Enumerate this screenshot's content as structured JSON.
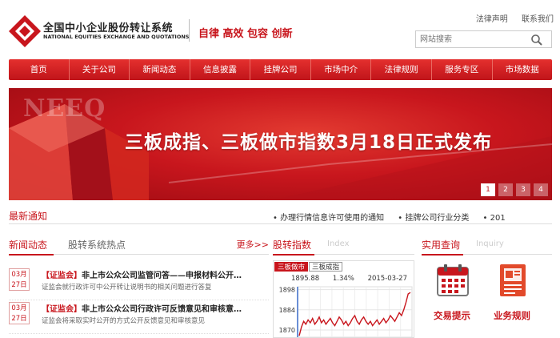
{
  "header": {
    "logo_cn": "全国中小企业股份转让系统",
    "logo_en": "NATIONAL EQUITIES EXCHANGE AND QUOTATIONS",
    "slogan": "自律 高效 包容 创新",
    "top_links": [
      "法律声明",
      "联系我们"
    ],
    "search_placeholder": "网站搜索"
  },
  "nav": [
    "首页",
    "关于公司",
    "新闻动态",
    "信息披露",
    "挂牌公司",
    "市场中介",
    "法律规则",
    "服务专区",
    "市场数据"
  ],
  "banner": {
    "watermark": "NEEQ",
    "title": "三板成指、三板做市指数3月18日正式发布",
    "pages": [
      "1",
      "2",
      "3",
      "4"
    ],
    "active_page": "1"
  },
  "notice": {
    "title": "最新通知",
    "items": [
      "• 办理行情信息许可使用的通知",
      "• 挂牌公司行业分类",
      "• 201"
    ]
  },
  "news": {
    "tab1": "新闻动态",
    "tab2": "股转系统热点",
    "more": "更多>>",
    "items": [
      {
        "month": "03月",
        "day": "27日",
        "tag": "【证监会】",
        "title": "非上市公众公司监管问答——申报材料公开…",
        "sub": "证监会就行政许可中公开转让说明书的相关问题进行答复"
      },
      {
        "month": "03月",
        "day": "27日",
        "tag": "【证监会】",
        "title": "非上市公众公司行政许可反馈意见和审核意…",
        "sub": "证监会将采取实时公开的方式公开反馈意见和审核意见"
      }
    ]
  },
  "index": {
    "title": "股转指数",
    "title_en": "Index",
    "tabs": [
      "三板做市",
      "三板成指"
    ],
    "active_tab": "三板做市",
    "value": "1895.88",
    "change": "1.34%",
    "date": "2015-03-27",
    "y_ticks": [
      "1898",
      "1884",
      "1870"
    ]
  },
  "chart_data": {
    "type": "line",
    "title": "",
    "ylim": [
      1865,
      1900
    ],
    "y_ticks": [
      1898,
      1884,
      1870
    ],
    "series": [
      {
        "values": [
          1866,
          1872,
          1876,
          1874,
          1877,
          1875,
          1878,
          1874,
          1876,
          1879,
          1875,
          1877,
          1874,
          1876,
          1878,
          1875,
          1873,
          1876,
          1879,
          1877,
          1874,
          1876,
          1873,
          1875,
          1878,
          1880,
          1876,
          1874,
          1877,
          1879,
          1876,
          1874,
          1876,
          1873,
          1875,
          1877,
          1874,
          1876,
          1878,
          1875,
          1877,
          1880,
          1878,
          1876,
          1879,
          1882,
          1880,
          1884,
          1889,
          1895,
          1896
        ]
      }
    ]
  },
  "quick": {
    "title": "实用查询",
    "title_en": "Inquiry",
    "items": [
      {
        "label": "交易提示",
        "icon": "calendar-icon"
      },
      {
        "label": "业务规则",
        "icon": "document-icon"
      }
    ]
  },
  "colors": {
    "brand_red": "#c8161d",
    "dark_red": "#9b0b12"
  }
}
